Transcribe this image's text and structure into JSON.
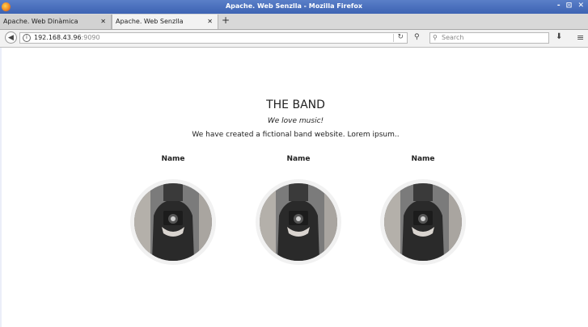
{
  "window": {
    "title": "Apache. Web Senzlla - Mozilla Firefox",
    "controls": "- ⊡ ✕"
  },
  "tabs": [
    {
      "label": "Apache. Web Dinàmica",
      "close": "✕"
    },
    {
      "label": "Apache. Web Senzlla",
      "close": "✕"
    }
  ],
  "new_tab": "+",
  "navbar": {
    "url_host": "192.168.43.96",
    "url_port": ":9090",
    "search_placeholder": "Search"
  },
  "page": {
    "title": "THE BAND",
    "tagline": "We love music!",
    "description": "We have created a fictional band website. Lorem ipsum.."
  },
  "members": [
    {
      "name": "Name"
    },
    {
      "name": "Name"
    },
    {
      "name": "Name"
    }
  ]
}
